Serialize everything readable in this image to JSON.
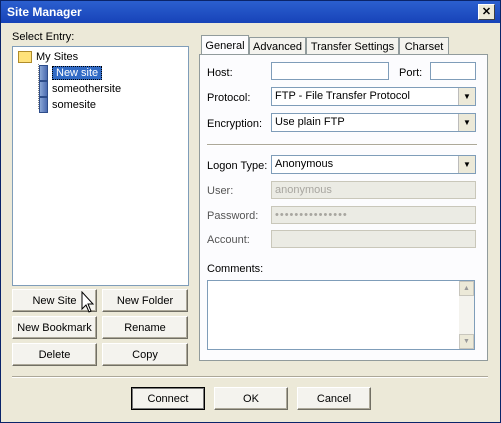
{
  "window": {
    "title": "Site Manager",
    "close_glyph": "✕"
  },
  "left": {
    "select_entry_label": "Select Entry:",
    "tree": {
      "root": "My Sites",
      "items": [
        "New site",
        "someothersite",
        "somesite"
      ],
      "selected": "New site"
    },
    "buttons": {
      "new_site": "New Site",
      "new_folder": "New Folder",
      "new_bookmark": "New Bookmark",
      "rename": "Rename",
      "delete": "Delete",
      "copy": "Copy"
    }
  },
  "tabs": [
    "General",
    "Advanced",
    "Transfer Settings",
    "Charset"
  ],
  "general": {
    "host_label": "Host:",
    "host_value": "",
    "port_label": "Port:",
    "port_value": "",
    "protocol_label": "Protocol:",
    "protocol_value": "FTP - File Transfer Protocol",
    "encryption_label": "Encryption:",
    "encryption_value": "Use plain FTP",
    "logon_type_label": "Logon Type:",
    "logon_type_value": "Anonymous",
    "user_label": "User:",
    "user_value": "anonymous",
    "password_label": "Password:",
    "password_value": "•••••••••••••••",
    "account_label": "Account:",
    "account_value": "",
    "comments_label": "Comments:",
    "comments_value": ""
  },
  "footer": {
    "connect": "Connect",
    "ok": "OK",
    "cancel": "Cancel"
  },
  "icons": {
    "dropdown": "chevron-down-icon",
    "scroll_up": "scroll-up-icon",
    "scroll_down": "scroll-down-icon",
    "folder": "folder-icon",
    "server": "server-icon",
    "cursor": "mouse-pointer-icon"
  },
  "colors": {
    "titlebar": "#1743b8",
    "selection": "#316ac5",
    "dialog": "#ece9d8"
  }
}
